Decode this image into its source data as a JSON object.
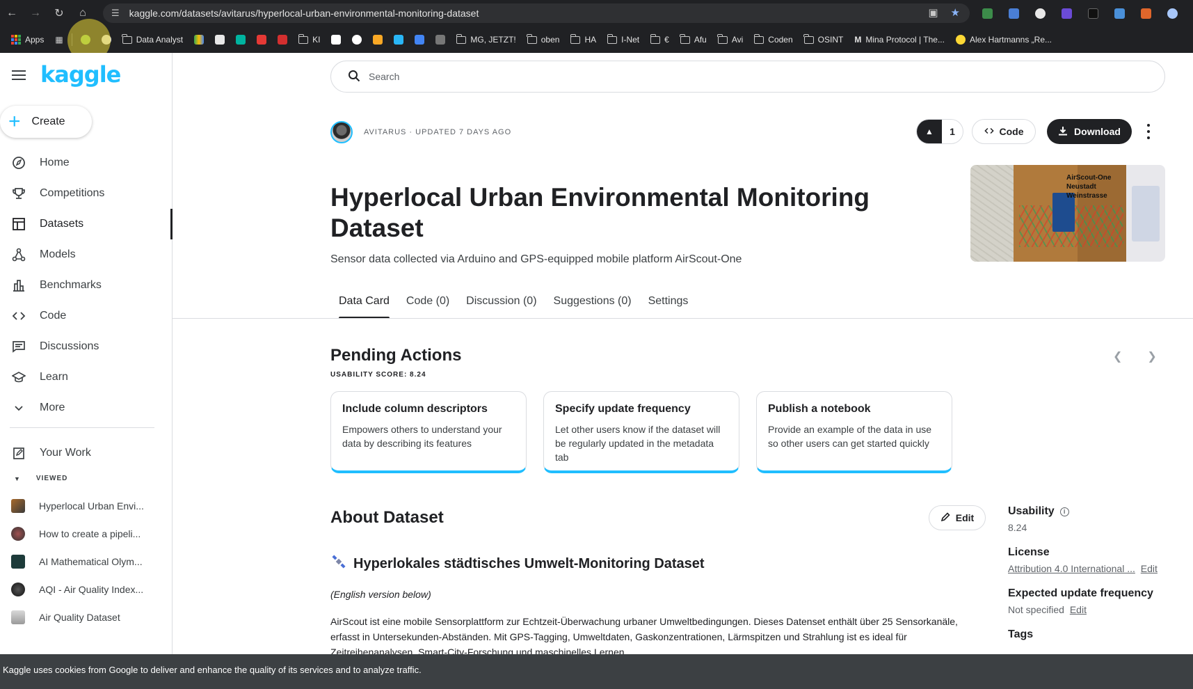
{
  "browser": {
    "url": "kaggle.com/datasets/avitarus/hyperlocal-urban-environmental-monitoring-dataset",
    "bookmarks": [
      "Apps",
      "Data Analyst",
      "KI",
      "MG, JETZT!",
      "oben",
      "HA",
      "I-Net",
      "€",
      "Afu",
      "Avi",
      "Coden",
      "OSINT",
      "Mina Protocol | The...",
      "Alex Hartmanns „Re..."
    ]
  },
  "sidebar": {
    "logo": "kaggle",
    "create_label": "Create",
    "nav": [
      {
        "label": "Home",
        "icon": "compass-icon"
      },
      {
        "label": "Competitions",
        "icon": "trophy-icon"
      },
      {
        "label": "Datasets",
        "icon": "table-icon",
        "active": true
      },
      {
        "label": "Models",
        "icon": "models-icon"
      },
      {
        "label": "Benchmarks",
        "icon": "bar-chart-icon"
      },
      {
        "label": "Code",
        "icon": "code-icon"
      },
      {
        "label": "Discussions",
        "icon": "comments-icon"
      },
      {
        "label": "Learn",
        "icon": "graduation-cap-icon"
      },
      {
        "label": "More",
        "icon": "chevron-down-icon"
      }
    ],
    "your_work": "Your Work",
    "viewed_label": "VIEWED",
    "viewed": [
      "Hyperlocal Urban Envi...",
      "How to create a pipeli...",
      "AI Mathematical Olym...",
      "AQI - Air Quality Index...",
      "Air Quality Dataset"
    ]
  },
  "search": {
    "placeholder": "Search"
  },
  "dataset": {
    "owner_meta": "AVITARUS · UPDATED 7 DAYS AGO",
    "votes": "1",
    "code_label": "Code",
    "download_label": "Download",
    "title": "Hyperlocal Urban Environmental Monitoring Dataset",
    "subtitle": "Sensor data collected via Arduino and GPS-equipped mobile platform AirScout-One",
    "cover_text": [
      "AirScout-One",
      "Neustadt",
      "Weinstrasse"
    ]
  },
  "tabs": [
    "Data Card",
    "Code (0)",
    "Discussion (0)",
    "Suggestions (0)",
    "Settings"
  ],
  "pending": {
    "title": "Pending Actions",
    "score": "USABILITY SCORE: 8.24",
    "cards": [
      {
        "title": "Include column descriptors",
        "text": "Empowers others to understand your data by describing its features"
      },
      {
        "title": "Specify update frequency",
        "text": "Let other users know if the dataset will be regularly updated in the metadata tab"
      },
      {
        "title": "Publish a notebook",
        "text": "Provide an example of the data in use so other users can get started quickly"
      }
    ]
  },
  "about": {
    "title": "About Dataset",
    "edit_label": "Edit",
    "heading": "Hyperlokales städtisches Umwelt-Monitoring Dataset",
    "english_note": "(English version below)",
    "body": "AirScout ist eine mobile Sensorplattform zur Echtzeit-Überwachung urbaner Umweltbedingungen. Dieses Datenset enthält über 25 Sensorkanäle, erfasst in Untersekunden-Abständen. Mit GPS-Tagging, Umweltdaten, Gaskonzentrationen, Lärmspitzen und Strahlung ist es ideal für Zeitreihenanalysen, Smart-City-Forschung und maschinelles Lernen."
  },
  "meta": {
    "usability_label": "Usability",
    "usability_value": "8.24",
    "license_label": "License",
    "license_value": "Attribution 4.0 International ...",
    "update_label": "Expected update frequency",
    "update_value": "Not specified",
    "edit": "Edit",
    "tags_label": "Tags"
  },
  "cookie_text": "Kaggle uses cookies from Google to deliver and enhance the quality of its services and to analyze traffic.",
  "colors": {
    "accent": "#20beff",
    "dark": "#202124"
  }
}
